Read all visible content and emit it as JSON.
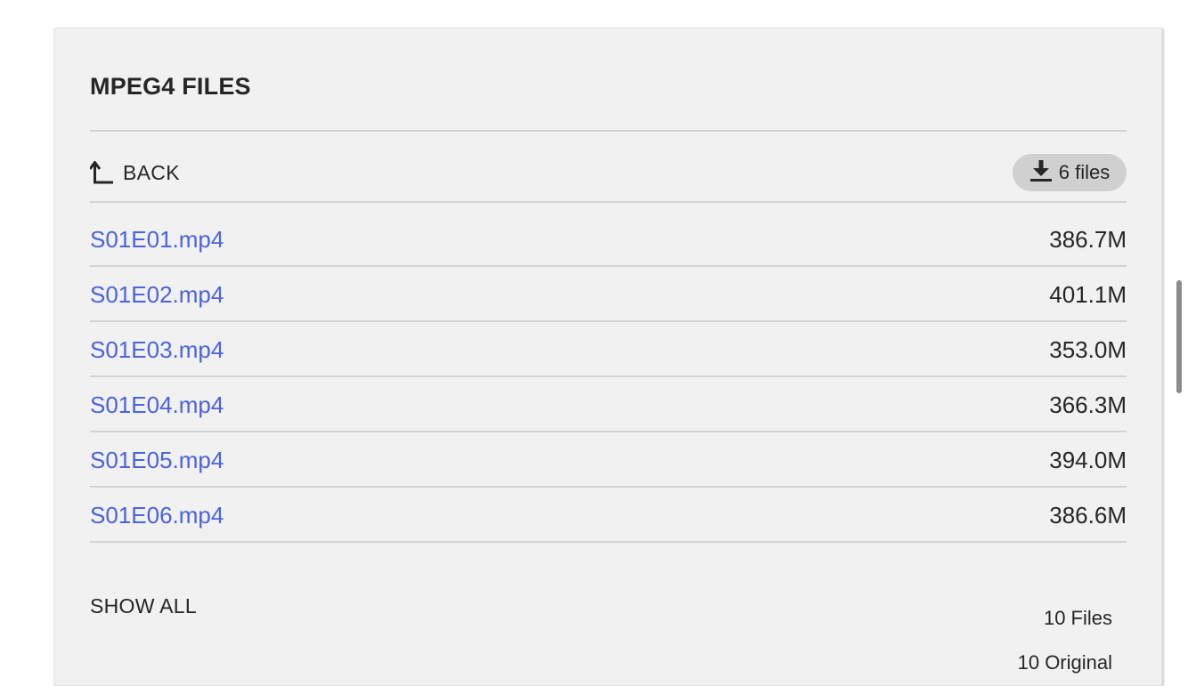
{
  "section": {
    "title": "MPEG4 FILES"
  },
  "toolbar": {
    "back_label": "BACK",
    "download_label": "6 files"
  },
  "files": [
    {
      "name": "S01E01.mp4",
      "size": "386.7M"
    },
    {
      "name": "S01E02.mp4",
      "size": "401.1M"
    },
    {
      "name": "S01E03.mp4",
      "size": "353.0M"
    },
    {
      "name": "S01E04.mp4",
      "size": "366.3M"
    },
    {
      "name": "S01E05.mp4",
      "size": "394.0M"
    },
    {
      "name": "S01E06.mp4",
      "size": "386.6M"
    }
  ],
  "footer": {
    "show_all_label": "SHOW ALL",
    "files_count": "10 Files",
    "original_count": "10 Original"
  },
  "colors": {
    "link": "#4a63e0",
    "panel_bg": "#f1f1f1",
    "button_bg": "#d0d0d0",
    "text": "#262626"
  },
  "icons": {
    "back": "back-arrow-icon",
    "download": "download-icon"
  }
}
